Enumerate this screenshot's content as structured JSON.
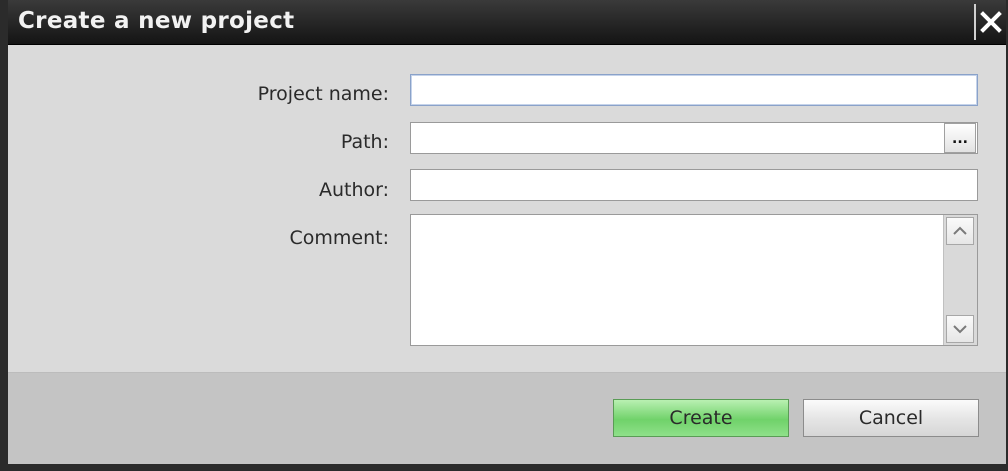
{
  "dialog": {
    "title": "Create a new project",
    "close_icon": "close-x-icon"
  },
  "form": {
    "project_name": {
      "label": "Project name:",
      "value": "",
      "placeholder": ""
    },
    "path": {
      "label": "Path:",
      "value": "",
      "placeholder": "",
      "browse_label": "..."
    },
    "author": {
      "label": "Author:",
      "value": "",
      "placeholder": ""
    },
    "comment": {
      "label": "Comment:",
      "value": "",
      "placeholder": ""
    }
  },
  "buttons": {
    "create_label": "Create",
    "cancel_label": "Cancel"
  },
  "colors": {
    "create_button": "#7ad674",
    "title_bar": "#1e1e1e"
  }
}
